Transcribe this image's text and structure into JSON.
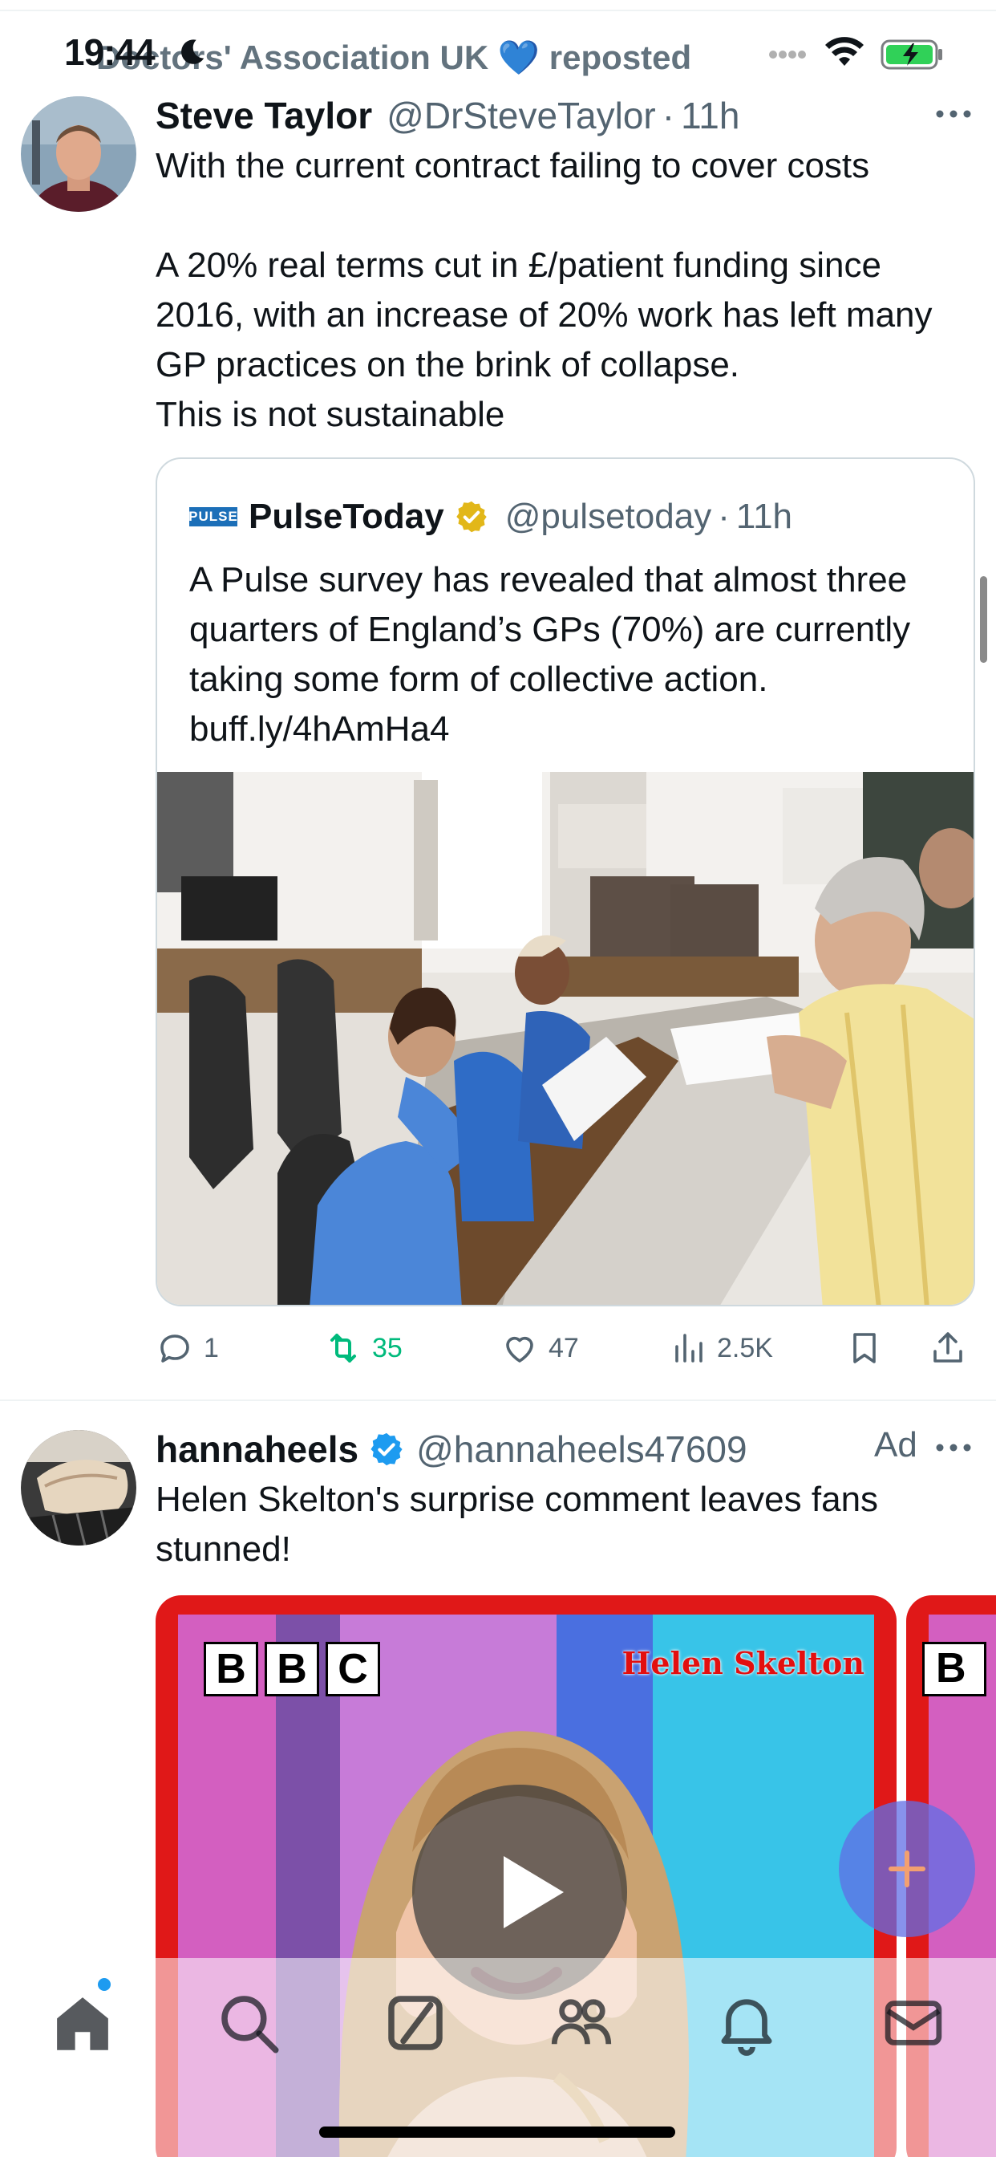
{
  "status_bar": {
    "time": "19:44",
    "repost_banner": "Doctors' Association UK 💙 reposted"
  },
  "tweet1": {
    "name": "Steve Taylor",
    "handle": "@DrSteveTaylor",
    "separator": "·",
    "time": "11h",
    "text": "With the current contract failing to cover costs\n\nA 20% real terms cut in £/patient funding since 2016, with an increase of 20% work has left many GP practices on the brink of collapse.\nThis is not sustainable",
    "quote": {
      "logo_text": "PULSE",
      "name": "PulseToday",
      "handle": "@pulsetoday",
      "separator": "·",
      "time": "11h",
      "text": "A Pulse survey has revealed that almost three quarters of England’s GPs (70%) are currently taking some form of collective action. buff.ly/4hAmHa4"
    },
    "actions": {
      "replies": "1",
      "reposts": "35",
      "likes": "47",
      "views": "2.5K"
    }
  },
  "tweet2": {
    "name": "hannaheels",
    "handle": "@hannaheels47609",
    "ad_label": "Ad",
    "text": "Helen Skelton's surprise comment leaves fans stunned!",
    "media": {
      "bbc_letters": [
        "B",
        "B",
        "C"
      ],
      "bbc_letter_small": "B",
      "caption_name": "Helen Skelton"
    }
  },
  "colors": {
    "text_primary": "#0f1419",
    "text_secondary": "#536471",
    "retweet_green": "#00ba7c",
    "verified_blue": "#1d9bf0",
    "verified_gold": "#e2b719",
    "bbc_frame_red": "#e01818"
  },
  "icons": {
    "status": [
      "moon-icon",
      "cellular-icon",
      "wifi-icon",
      "battery-charging-icon"
    ],
    "actions": [
      "reply-icon",
      "retweet-icon",
      "like-icon",
      "views-icon",
      "bookmark-icon",
      "share-icon"
    ],
    "tabs": [
      "home-icon",
      "search-icon",
      "grok-icon",
      "communities-icon",
      "notifications-icon",
      "messages-icon"
    ]
  }
}
